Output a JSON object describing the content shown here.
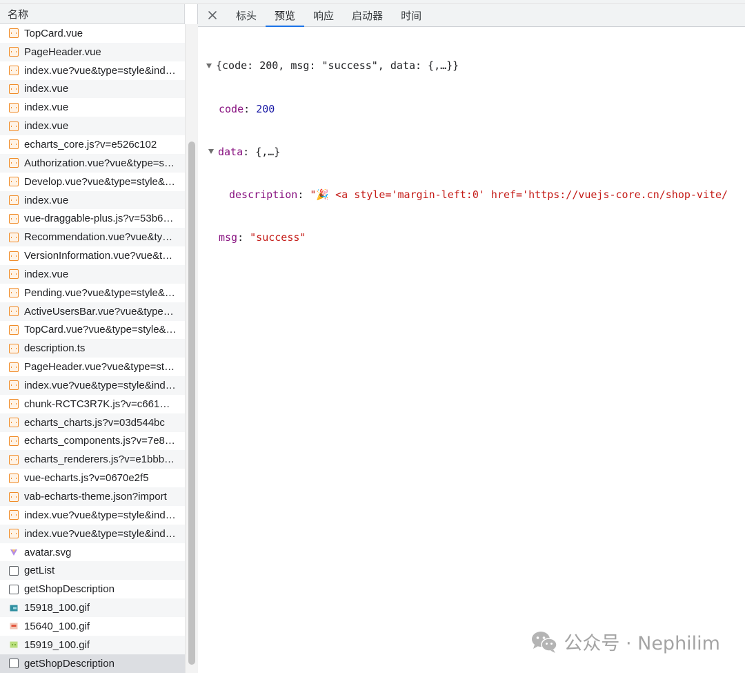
{
  "network_list": {
    "header": "名称",
    "rows": [
      {
        "name": "TopCard.vue",
        "type": "script"
      },
      {
        "name": "PageHeader.vue",
        "type": "script"
      },
      {
        "name": "index.vue?vue&type=style&ind…",
        "type": "script"
      },
      {
        "name": "index.vue",
        "type": "script"
      },
      {
        "name": "index.vue",
        "type": "script"
      },
      {
        "name": "index.vue",
        "type": "script"
      },
      {
        "name": "echarts_core.js?v=e526c102",
        "type": "script"
      },
      {
        "name": "Authorization.vue?vue&type=s…",
        "type": "script"
      },
      {
        "name": "Develop.vue?vue&type=style&…",
        "type": "script"
      },
      {
        "name": "index.vue",
        "type": "script"
      },
      {
        "name": "vue-draggable-plus.js?v=53b6…",
        "type": "script"
      },
      {
        "name": "Recommendation.vue?vue&ty…",
        "type": "script"
      },
      {
        "name": "VersionInformation.vue?vue&t…",
        "type": "script"
      },
      {
        "name": "index.vue",
        "type": "script"
      },
      {
        "name": "Pending.vue?vue&type=style&…",
        "type": "script"
      },
      {
        "name": "ActiveUsersBar.vue?vue&type…",
        "type": "script"
      },
      {
        "name": "TopCard.vue?vue&type=style&…",
        "type": "script"
      },
      {
        "name": "description.ts",
        "type": "script"
      },
      {
        "name": "PageHeader.vue?vue&type=st…",
        "type": "script"
      },
      {
        "name": "index.vue?vue&type=style&ind…",
        "type": "script"
      },
      {
        "name": "chunk-RCTC3R7K.js?v=c661…",
        "type": "script"
      },
      {
        "name": "echarts_charts.js?v=03d544bc",
        "type": "script"
      },
      {
        "name": "echarts_components.js?v=7e8…",
        "type": "script"
      },
      {
        "name": "echarts_renderers.js?v=e1bbb…",
        "type": "script"
      },
      {
        "name": "vue-echarts.js?v=0670e2f5",
        "type": "script"
      },
      {
        "name": "vab-echarts-theme.json?import",
        "type": "script"
      },
      {
        "name": "index.vue?vue&type=style&ind…",
        "type": "script"
      },
      {
        "name": "index.vue?vue&type=style&ind…",
        "type": "script"
      },
      {
        "name": "avatar.svg",
        "type": "svg"
      },
      {
        "name": "getList",
        "type": "fetch"
      },
      {
        "name": "getShopDescription",
        "type": "fetch"
      },
      {
        "name": "15918_100.gif",
        "type": "gif-teal"
      },
      {
        "name": "15640_100.gif",
        "type": "gif-red"
      },
      {
        "name": "15919_100.gif",
        "type": "gif-green"
      },
      {
        "name": "getShopDescription",
        "type": "fetch",
        "selected": true
      }
    ]
  },
  "detail_tabs": {
    "close_icon": "close-icon",
    "tabs": [
      "标头",
      "预览",
      "响应",
      "启动器",
      "时间"
    ],
    "active": "预览"
  },
  "json_preview": {
    "root_summary": "{code: 200, msg: \"success\", data: {,…}}",
    "code_key": "code",
    "code_value": "200",
    "data_key": "data",
    "data_summary": "{,…}",
    "description_key": "description",
    "description_value": "\"🎉 <a style='margin-left:0' href='https://vuejs-core.cn/shop-vite/",
    "msg_key": "msg",
    "msg_value": "\"success\""
  },
  "watermark": {
    "icon": "wechat-icon",
    "text": "公众号 · Nephilim"
  },
  "colors": {
    "tab_active_underline": "#1a73e8",
    "json_key": "#881280",
    "json_number": "#1a1aa6",
    "json_string": "#c41a16",
    "script_icon": "#f08c29"
  }
}
